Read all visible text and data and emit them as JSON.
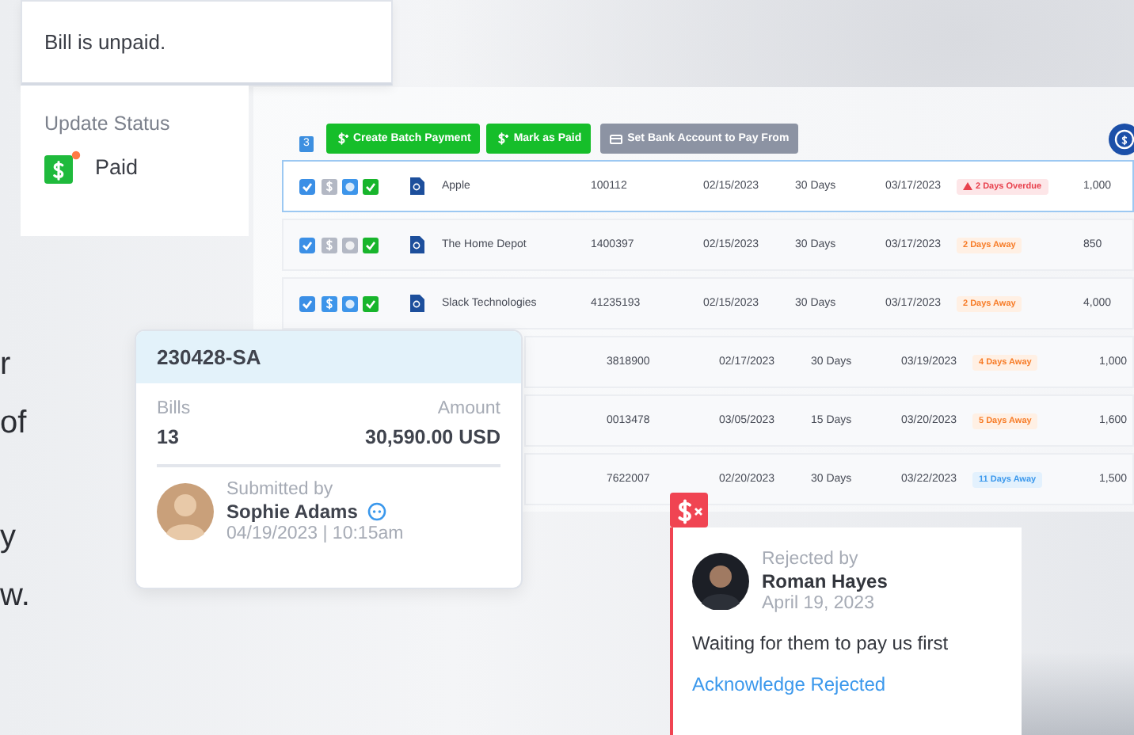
{
  "status_card": {
    "message": "Bill is unpaid.",
    "section_label": "Update Status",
    "status": "Paid",
    "has_alert": true
  },
  "toolbar": {
    "selected_count": "3",
    "buttons": [
      {
        "label": "Create Batch Payment",
        "kind": "primary"
      },
      {
        "label": "Mark as Paid",
        "kind": "primary"
      },
      {
        "label": "Set Bank Account to Pay From",
        "kind": "secondary"
      }
    ]
  },
  "bills": [
    {
      "checked": true,
      "selected": true,
      "payment_ready": false,
      "has_comment": true,
      "approved": true,
      "name": "Apple",
      "invoice": "100112",
      "date": "02/15/2023",
      "terms": "30 Days",
      "due": "03/17/2023",
      "badge": {
        "text": "2 Days Overdue",
        "kind": "overdue"
      },
      "amount": "1,000"
    },
    {
      "checked": true,
      "selected": false,
      "payment_ready": false,
      "has_comment": false,
      "approved": true,
      "name": "The Home Depot",
      "invoice": "1400397",
      "date": "02/15/2023",
      "terms": "30 Days",
      "due": "03/17/2023",
      "badge": {
        "text": "2 Days Away",
        "kind": "soon"
      },
      "amount": "850"
    },
    {
      "checked": true,
      "selected": false,
      "payment_ready": true,
      "has_comment": true,
      "approved": true,
      "name": "Slack Technologies",
      "invoice": "41235193",
      "date": "02/15/2023",
      "terms": "30 Days",
      "due": "03/17/2023",
      "badge": {
        "text": "2 Days Away",
        "kind": "soon"
      },
      "amount": "4,000"
    },
    {
      "selected": false,
      "invoice": "3818900",
      "date": "02/17/2023",
      "terms": "30 Days",
      "due": "03/19/2023",
      "badge": {
        "text": "4 Days Away",
        "kind": "soon"
      },
      "amount": "1,000"
    },
    {
      "selected": false,
      "invoice": "0013478",
      "date": "03/05/2023",
      "terms": "15 Days",
      "due": "03/20/2023",
      "badge": {
        "text": "5 Days Away",
        "kind": "soon"
      },
      "amount": "1,600"
    },
    {
      "selected": false,
      "invoice": "7622007",
      "date": "02/20/2023",
      "terms": "30 Days",
      "due": "03/22/2023",
      "badge": {
        "text": "11 Days Away",
        "kind": "later"
      },
      "amount": "1,500"
    }
  ],
  "batch_card": {
    "batch_id": "230428-SA",
    "bills_label": "Bills",
    "bills_count": "13",
    "amount_label": "Amount",
    "amount": "30,590.00 USD",
    "submitted_label": "Submitted by",
    "submitter": "Sophie Adams",
    "submitted_at": "04/19/2023 | 10:15am"
  },
  "rejection_card": {
    "label": "Rejected by",
    "rejector": "Roman Hayes",
    "date": "April 19, 2023",
    "comment": "Waiting for them to pay us first",
    "action": "Acknowledge Rejected"
  },
  "side_paragraphs": [
    [
      "r",
      "of"
    ],
    [
      "y",
      "w."
    ]
  ]
}
